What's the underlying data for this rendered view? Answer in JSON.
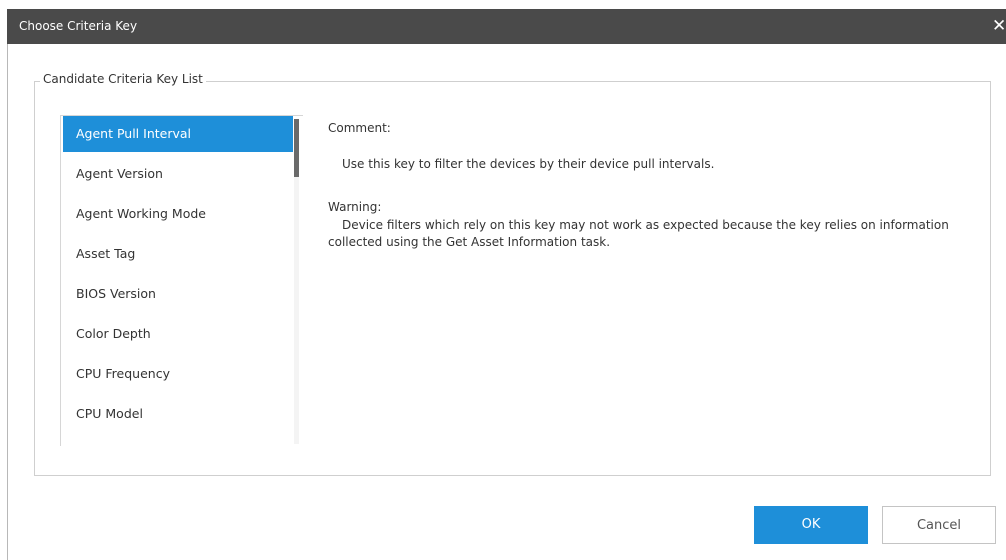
{
  "window": {
    "title": "Choose Criteria Key",
    "close_icon": "close-icon"
  },
  "group": {
    "legend": "Candidate Criteria Key List"
  },
  "list": {
    "selected_index": 0,
    "items": [
      "Agent Pull Interval",
      "Agent Version",
      "Agent Working Mode",
      "Asset Tag",
      "BIOS Version",
      "Color Depth",
      "CPU Frequency",
      "CPU Model"
    ]
  },
  "details": {
    "comment_label": "Comment:",
    "comment_text": "Use this key to filter the devices by their device pull intervals.",
    "warning_label": "Warning:",
    "warning_text": "Device filters which rely on this key may not work as expected because the key relies on information collected using the Get Asset Information task."
  },
  "buttons": {
    "ok": "OK",
    "cancel": "Cancel"
  },
  "colors": {
    "titlebar": "#4a4a4a",
    "accent": "#1e8fd9"
  }
}
